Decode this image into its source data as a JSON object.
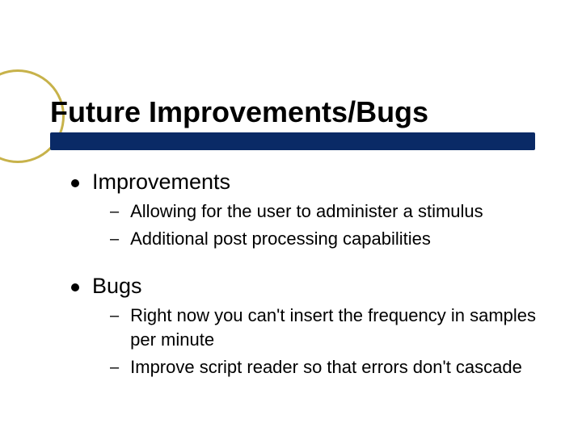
{
  "slide": {
    "title": "Future Improvements/Bugs",
    "sections": [
      {
        "heading": "Improvements",
        "items": [
          "Allowing for the user to administer a stimulus",
          "Additional post processing capabilities"
        ]
      },
      {
        "heading": "Bugs",
        "items": [
          "Right now you can't insert the frequency in samples per minute",
          "Improve script reader so that errors don't cascade"
        ]
      }
    ]
  }
}
